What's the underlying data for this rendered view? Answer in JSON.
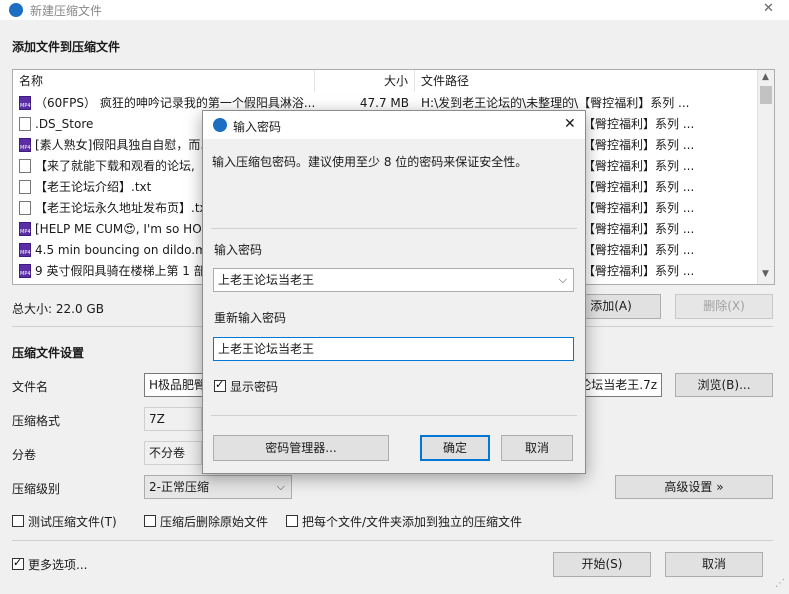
{
  "window": {
    "title": "新建压缩文件",
    "close_glyph": "✕"
  },
  "add_section": {
    "title": "添加文件到压缩文件"
  },
  "file_list": {
    "columns": {
      "name": "名称",
      "size": "大小",
      "path": "文件路径"
    },
    "rows": [
      {
        "icon": "video-file-icon",
        "name": "（60FPS） 疯狂的呻吟记录我的第一个假阳具淋浴...",
        "size": "47.7 MB",
        "path": "H:\\发到老王论坛的\\未整理的\\【臀控福利】系列 ..."
      },
      {
        "icon": "document-file-icon",
        "name": ".DS_Store",
        "size": "",
        "path": "【臀控福利】系列 ..."
      },
      {
        "icon": "video-file-icon",
        "name": "[素人熟女]假阳具独自自慰，而...",
        "size": "",
        "path": "【臀控福利】系列 ..."
      },
      {
        "icon": "document-file-icon",
        "name": "【来了就能下载和观看的论坛,",
        "size": "",
        "path": "【臀控福利】系列 ..."
      },
      {
        "icon": "document-file-icon",
        "name": "【老王论坛介绍】.txt",
        "size": "",
        "path": "【臀控福利】系列 ..."
      },
      {
        "icon": "document-file-icon",
        "name": "【老王论坛永久地址发布页】.tx",
        "size": "",
        "path": "【臀控福利】系列 ..."
      },
      {
        "icon": "video-file-icon",
        "name": "[HELP ME CUM😍, I'm so HO",
        "size": "",
        "path": "【臀控福利】系列 ..."
      },
      {
        "icon": "video-file-icon",
        "name": "4.5 min bouncing on dildo.m",
        "size": "",
        "path": "【臀控福利】系列 ..."
      },
      {
        "icon": "video-file-icon",
        "name": "9 英寸假阳具骑在楼梯上第 1 部",
        "size": "",
        "path": "【臀控福利】系列 ..."
      }
    ]
  },
  "total_size": "总大小: 22.0 GB",
  "buttons": {
    "add": "添加(A)",
    "delete": "删除(X)",
    "browse": "浏览(B)...",
    "advanced": "高级设置 »",
    "start": "开始(S)",
    "cancel": "取消"
  },
  "settings": {
    "title": "压缩文件设置",
    "filename_label": "文件名",
    "filename_value_left": "H极品肥臀",
    "filename_value_right": "论坛当老王.7z",
    "format_label": "压缩格式",
    "format_value": "7Z",
    "volume_label": "分卷",
    "volume_value": "不分卷",
    "level_label": "压缩级别",
    "level_value": "2-正常压缩"
  },
  "options": {
    "test": {
      "label": "测试压缩文件(T)",
      "checked": false
    },
    "delete_after": {
      "label": "压缩后删除原始文件",
      "checked": false
    },
    "separate": {
      "label": "把每个文件/文件夹添加到独立的压缩文件",
      "checked": false
    },
    "more": {
      "label": "更多选项...",
      "checked": true
    }
  },
  "dialog": {
    "title": "输入密码",
    "close_glyph": "✕",
    "description": "输入压缩包密码。建议使用至少 8 位的密码来保证安全性。",
    "password_label": "输入密码",
    "password_value": "上老王论坛当老王",
    "confirm_label": "重新输入密码",
    "confirm_value": "上老王论坛当老王",
    "show_password": {
      "label": "显示密码",
      "checked": true
    },
    "manager_button": "密码管理器...",
    "ok_button": "确定",
    "cancel_button": "取消"
  }
}
